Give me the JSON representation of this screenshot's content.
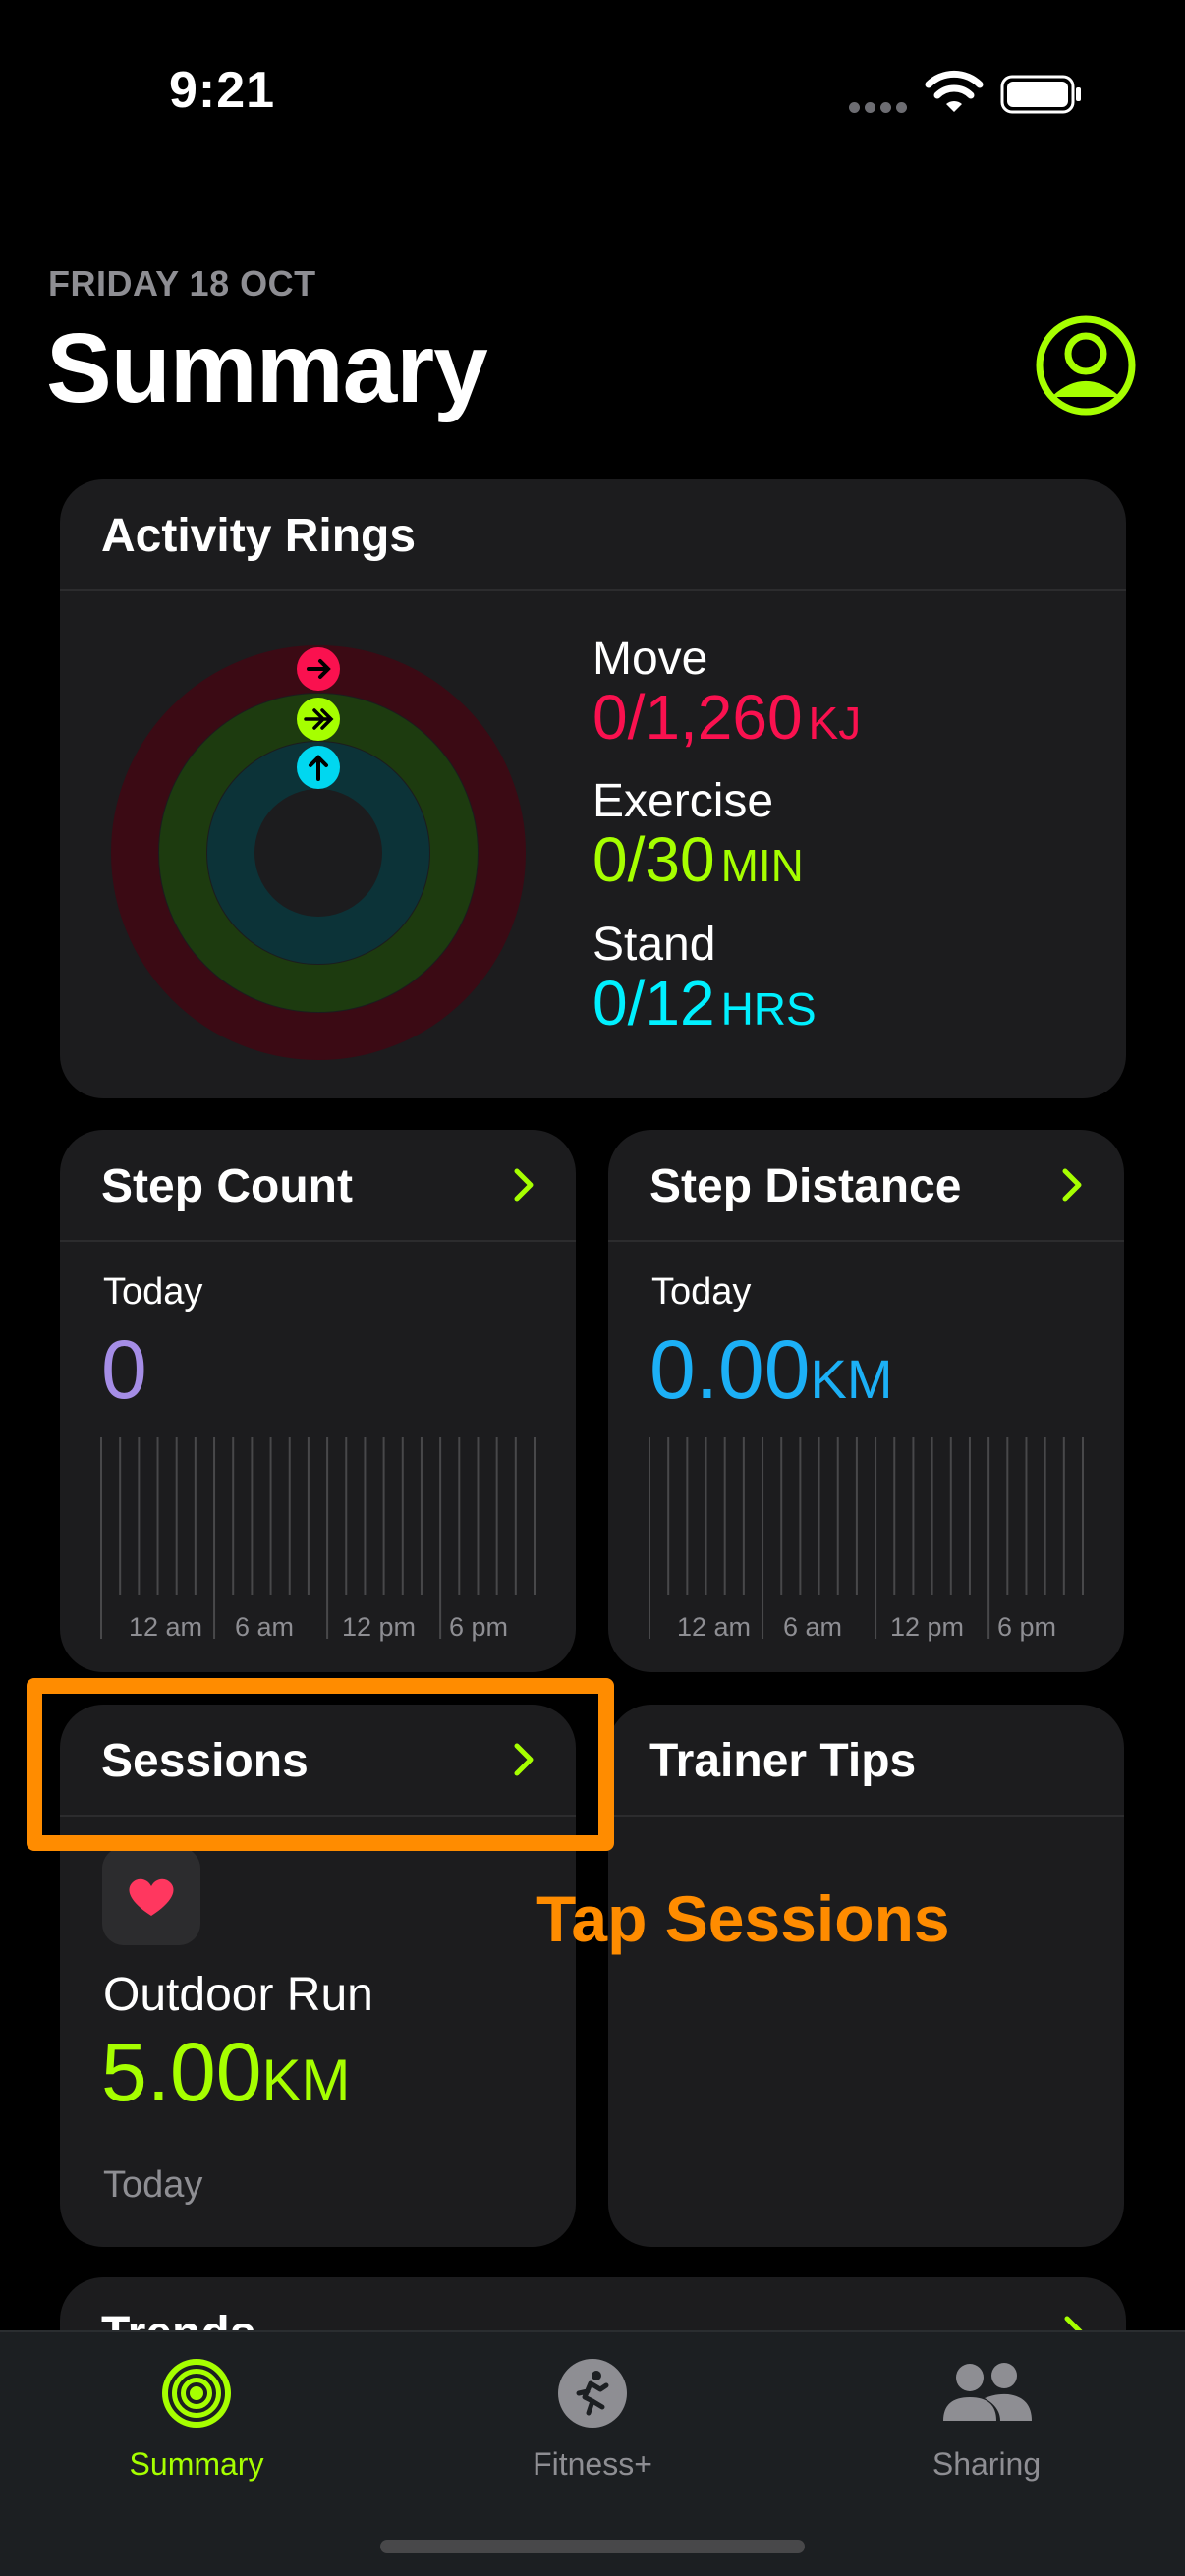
{
  "status": {
    "time": "9:21"
  },
  "header": {
    "date": "FRIDAY 18 OCT",
    "title": "Summary"
  },
  "activity": {
    "title": "Activity Rings",
    "move": {
      "label": "Move",
      "value": "0/1,260",
      "unit": "KJ",
      "color": "#fa114f"
    },
    "exercise": {
      "label": "Exercise",
      "value": "0/30",
      "unit": "MIN",
      "color": "#a6ff00"
    },
    "stand": {
      "label": "Stand",
      "value": "0/12",
      "unit": "HRS",
      "color": "#00f0ff"
    }
  },
  "step_count": {
    "title": "Step Count",
    "period": "Today",
    "value": "0",
    "axis": [
      "12 am",
      "6 am",
      "12 pm",
      "6 pm"
    ]
  },
  "step_distance": {
    "title": "Step Distance",
    "period": "Today",
    "value": "0.00",
    "unit": "KM",
    "axis": [
      "12 am",
      "6 am",
      "12 pm",
      "6 pm"
    ]
  },
  "sessions": {
    "title": "Sessions",
    "workout_icon": "heart-icon",
    "workout_name": "Outdoor Run",
    "distance": "5.00",
    "unit": "KM",
    "date": "Today"
  },
  "trainer_tips": {
    "title": "Trainer Tips"
  },
  "trends": {
    "title": "Trends"
  },
  "annotation": {
    "hint": "Tap Sessions",
    "color": "#ff8c00"
  },
  "tabs": [
    {
      "label": "Summary",
      "icon": "activity-rings-icon",
      "active": true
    },
    {
      "label": "Fitness+",
      "icon": "running-figure-icon",
      "active": false
    },
    {
      "label": "Sharing",
      "icon": "people-icon",
      "active": false
    }
  ]
}
